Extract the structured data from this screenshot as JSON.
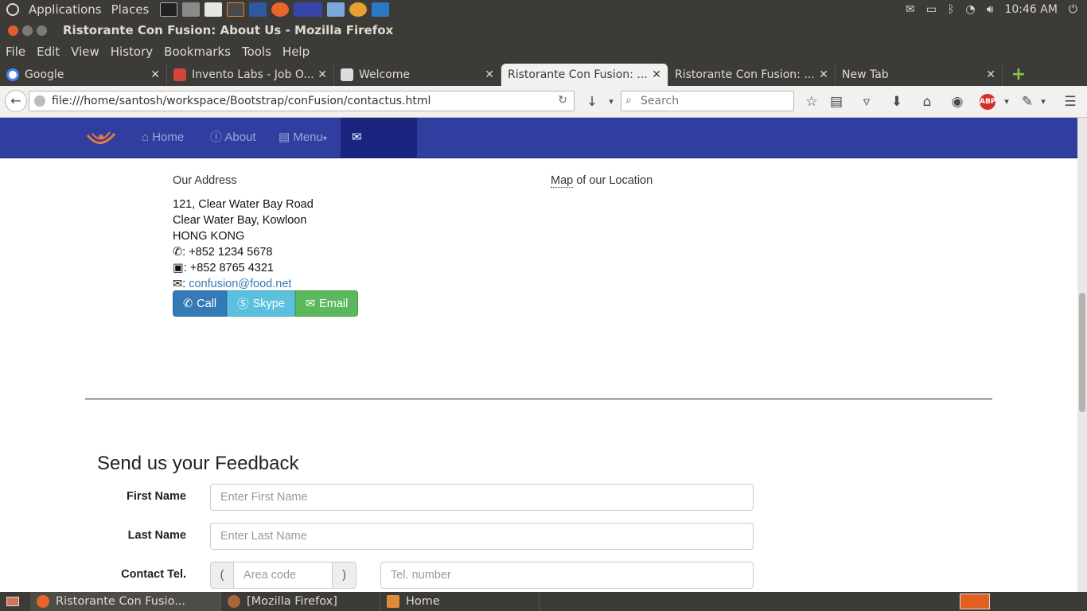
{
  "top_panel": {
    "applications": "Applications",
    "places": "Places",
    "clock": "10:46 AM"
  },
  "window": {
    "title": "Ristorante Con Fusion: About Us - Mozilla Firefox"
  },
  "menu": {
    "file": "File",
    "edit": "Edit",
    "view": "View",
    "history": "History",
    "bookmarks": "Bookmarks",
    "tools": "Tools",
    "help": "Help"
  },
  "tabs": [
    {
      "label": "Google"
    },
    {
      "label": "Invento Labs - Job O..."
    },
    {
      "label": "Welcome"
    },
    {
      "label": "Ristorante Con Fusion: ..."
    },
    {
      "label": "Ristorante Con Fusion: ..."
    },
    {
      "label": "New Tab"
    }
  ],
  "address_bar": {
    "url": "file:///home/santosh/workspace/Bootstrap/conFusion/contactus.html",
    "search_placeholder": "Search"
  },
  "site_nav": {
    "home": "Home",
    "about": "About",
    "menu": "Menu",
    "contact": "Contact"
  },
  "address": {
    "heading": "Our Address",
    "line1": "121, Clear Water Bay Road",
    "line2": "Clear Water Bay, Kowloon",
    "line3": "HONG KONG",
    "tel": ": +852 1234 5678",
    "fax": ": +852 8765 4321",
    "email_prefix": ":",
    "email": "confusion@food.net"
  },
  "map": {
    "abbr": "Map",
    "rest": " of our Location"
  },
  "buttons": {
    "call": "Call",
    "skype": "Skype",
    "email": "Email"
  },
  "feedback": {
    "heading": "Send us your Feedback",
    "first_name_label": "First Name",
    "first_name_placeholder": "Enter First Name",
    "last_name_label": "Last Name",
    "last_name_placeholder": "Enter Last Name",
    "tel_label": "Contact Tel.",
    "area_open": "(",
    "area_placeholder": "Area code",
    "area_close": ")",
    "tel_placeholder": "Tel. number"
  },
  "taskbar": [
    {
      "label": "Ristorante Con Fusio..."
    },
    {
      "label": "[Mozilla Firefox]"
    },
    {
      "label": "Home"
    }
  ],
  "colors": {
    "site_nav_bg": "#303f9f",
    "site_nav_active": "#1a237e",
    "call_btn": "#337ab7",
    "skype_btn": "#5bc0de",
    "email_btn": "#5cb85c"
  }
}
